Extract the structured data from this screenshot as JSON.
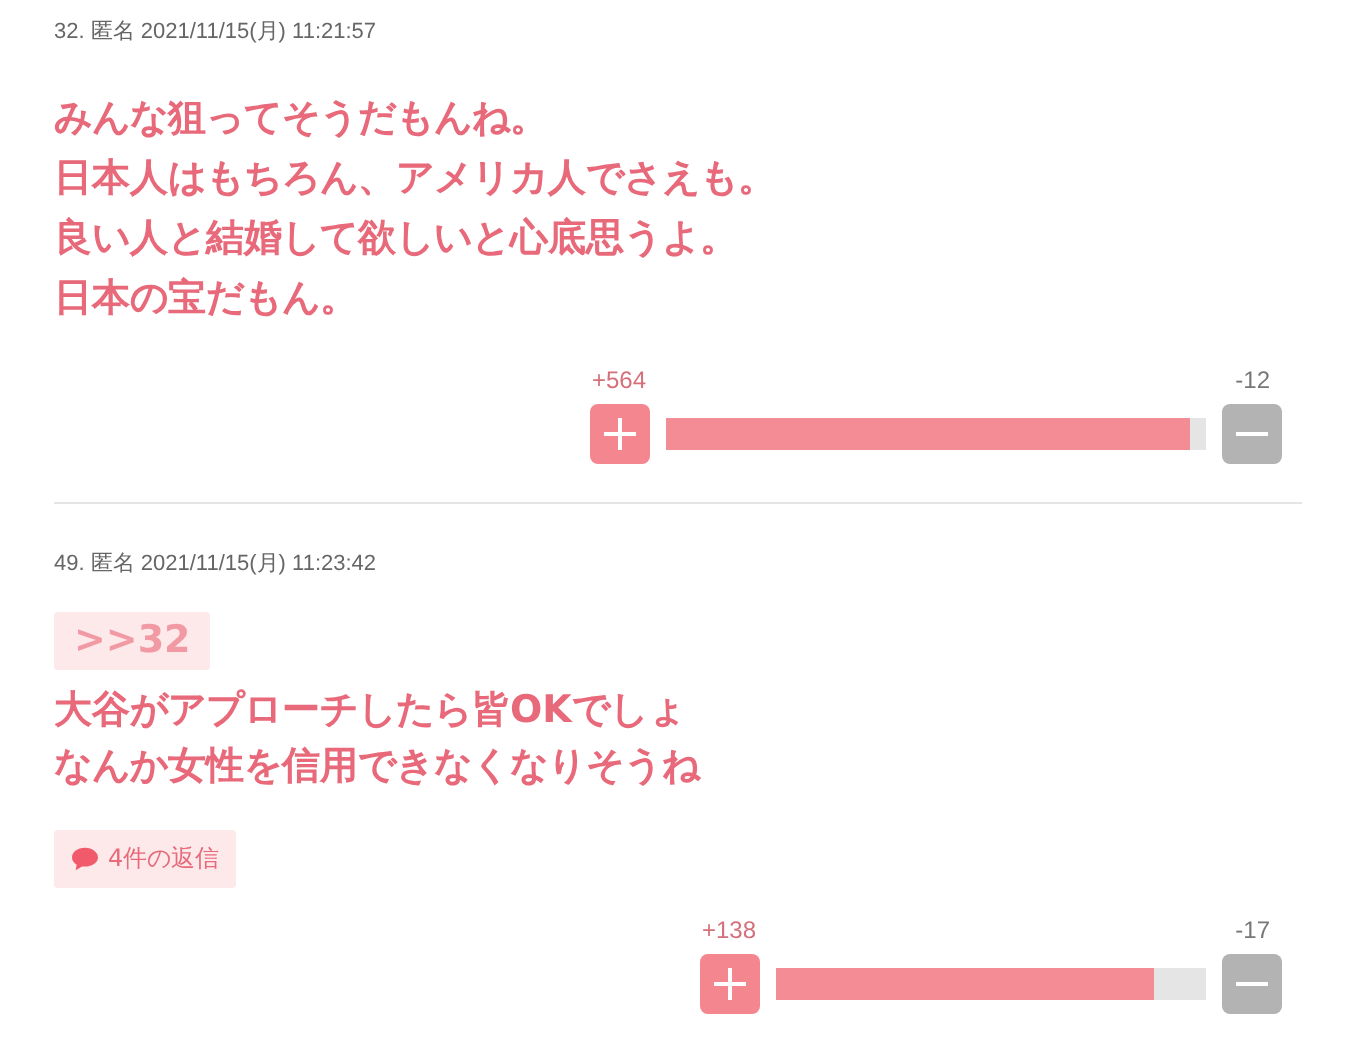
{
  "comments": [
    {
      "meta": "32. 匿名 2021/11/15(月) 11:21:57",
      "body": [
        "みんな狙ってそうだもんね。",
        "日本人はもちろん、アメリカ人でさえも。",
        "良い人と結婚して欲しいと心底思うよ。",
        "日本の宝だもん。"
      ],
      "plus": "+564",
      "minus": "-12",
      "level": 0.97
    },
    {
      "meta": "49. 匿名 2021/11/15(月) 11:23:42",
      "anchor": ">>32",
      "body": [
        "大谷がアプローチしたら皆OKでしょ",
        "なんか女性を信用できなくなりそうね"
      ],
      "replies": "4件の返信",
      "plus": "+138",
      "minus": "-17",
      "level": 0.88
    }
  ]
}
